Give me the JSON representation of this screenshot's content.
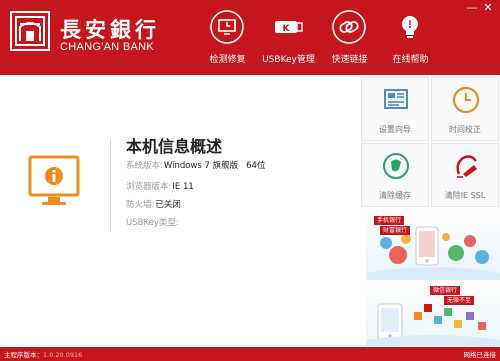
{
  "header": {
    "logo_cn": "長安銀行",
    "logo_en": "CHANG'AN BANK",
    "window_controls": [
      "—",
      "✕"
    ],
    "nav": [
      {
        "label": "检测修复",
        "icon": "monitor-check-icon"
      },
      {
        "label": "USBKey管理",
        "icon": "usb-key-icon"
      },
      {
        "label": "快速链接",
        "icon": "link-icon"
      },
      {
        "label": "在线帮助",
        "icon": "lightbulb-icon"
      }
    ]
  },
  "info": {
    "title": "本机信息概述",
    "os_label": "系统版本:",
    "os_value": "Windows 7  旗舰版",
    "os_bits": "64位",
    "browser_label": "浏览器版本:",
    "browser_value": "IE 11",
    "firewall_label": "防火墙:",
    "firewall_value": "已关闭",
    "usbkey_label": "USBKey类型:",
    "usbkey_value": ""
  },
  "tools": [
    {
      "label": "设置向导",
      "icon": "settings-wizard-icon"
    },
    {
      "label": "时间校正",
      "icon": "clock-icon"
    },
    {
      "label": "清除缓存",
      "icon": "clear-cache-icon"
    },
    {
      "label": "清除IE SSL",
      "icon": "clear-ssl-icon"
    }
  ],
  "ads": {
    "ad1_tag_1": "手机银行",
    "ad1_tag_2": "财富银行",
    "ad2_tag_1": "微信银行",
    "ad2_tag_2": "无微不至"
  },
  "status": {
    "version_label": "主程序版本：",
    "version_value": "1.0.20.0916",
    "network_label": "网络已连接"
  },
  "colors": {
    "brand_red": "#c4161c",
    "accent_orange": "#f08a1d"
  }
}
